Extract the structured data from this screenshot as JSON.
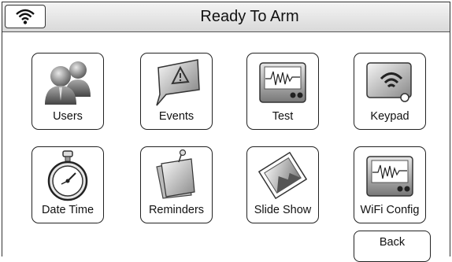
{
  "header": {
    "title": "Ready To Arm",
    "wifi_icon": "wifi-icon"
  },
  "tiles": [
    {
      "label": "Users",
      "icon": "users-icon"
    },
    {
      "label": "Events",
      "icon": "events-icon"
    },
    {
      "label": "Test",
      "icon": "test-icon"
    },
    {
      "label": "Keypad",
      "icon": "keypad-icon"
    },
    {
      "label": "Date Time",
      "icon": "stopwatch-icon"
    },
    {
      "label": "Reminders",
      "icon": "reminders-icon"
    },
    {
      "label": "Slide Show",
      "icon": "slideshow-icon"
    },
    {
      "label": "WiFi Config",
      "icon": "wifi-config-icon"
    }
  ],
  "back_label": "Back"
}
